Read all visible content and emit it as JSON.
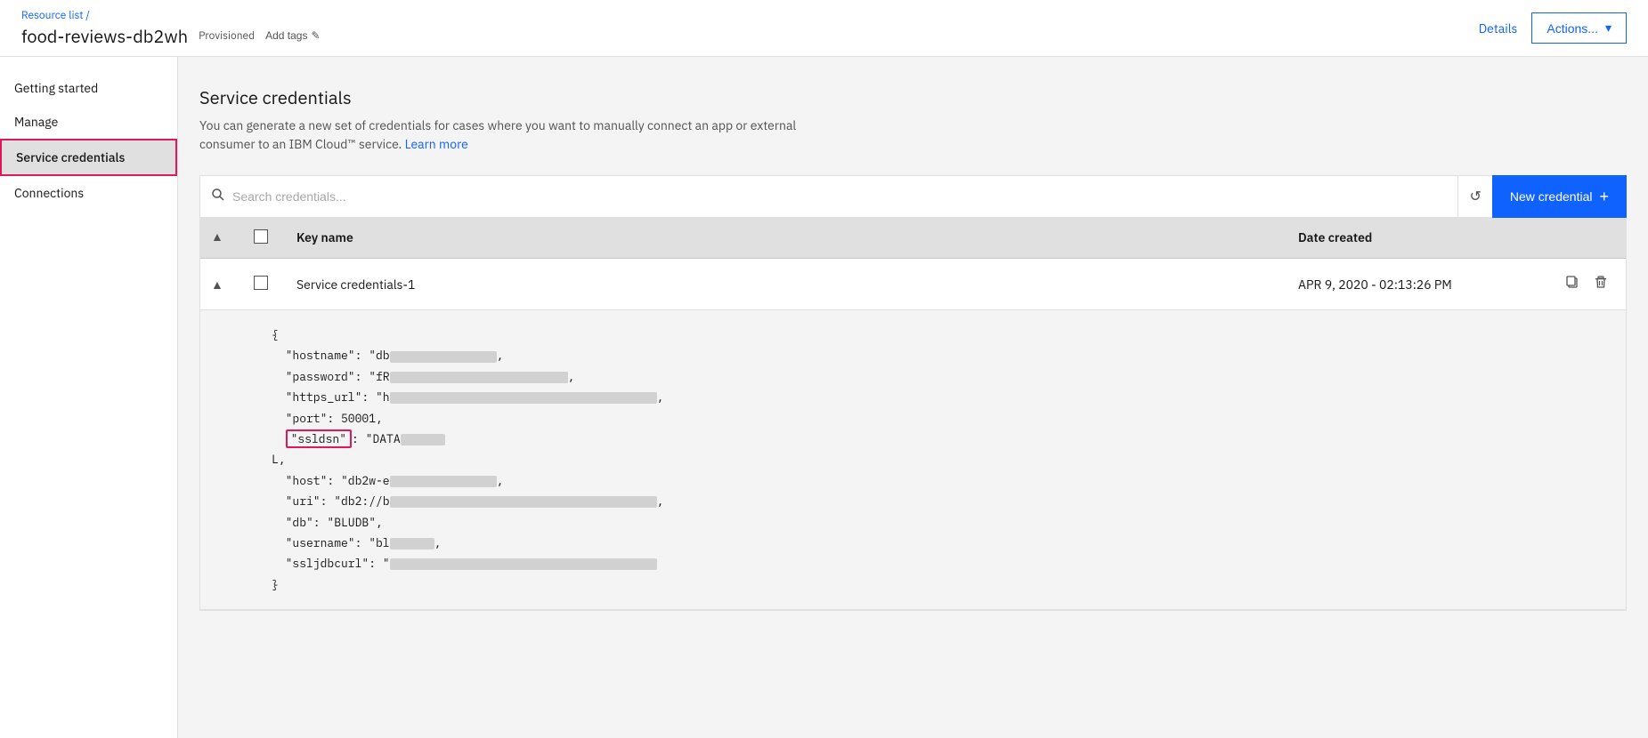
{
  "breadcrumb": {
    "label": "Resource list",
    "separator": "/"
  },
  "header": {
    "title": "food-reviews-db2wh",
    "status": "Provisioned",
    "add_tags_label": "Add tags",
    "details_label": "Details",
    "actions_label": "Actions..."
  },
  "sidebar": {
    "items": [
      {
        "id": "getting-started",
        "label": "Getting started",
        "active": false
      },
      {
        "id": "manage",
        "label": "Manage",
        "active": false
      },
      {
        "id": "service-credentials",
        "label": "Service credentials",
        "active": true
      },
      {
        "id": "connections",
        "label": "Connections",
        "active": false
      }
    ]
  },
  "main": {
    "section_title": "Service credentials",
    "section_desc": "You can generate a new set of credentials for cases where you want to manually connect an app or external consumer to an IBM Cloud™ service.",
    "learn_more_label": "Learn more",
    "search_placeholder": "Search credentials...",
    "new_credential_label": "New credential",
    "table": {
      "headers": [
        {
          "id": "expand",
          "label": ""
        },
        {
          "id": "checkbox",
          "label": ""
        },
        {
          "id": "key-name",
          "label": "Key name"
        },
        {
          "id": "date-created",
          "label": "Date created"
        },
        {
          "id": "actions",
          "label": ""
        }
      ],
      "rows": [
        {
          "id": "service-credentials-1",
          "key_name": "Service credentials-1",
          "date_created": "APR 9, 2020 - 02:13:26 PM",
          "expanded": true,
          "json_content": [
            {
              "line": "{"
            },
            {
              "line": "  \"hostname\": \"db",
              "key": "hostname",
              "value_blurred": true,
              "blur_size": "md"
            },
            {
              "line": "  \"password\": \"fR",
              "key": "password",
              "value_blurred": true,
              "blur_size": "lg"
            },
            {
              "line": "  \"https_url\": \"h",
              "key": "https_url",
              "value_blurred": true,
              "blur_size": "xl"
            },
            {
              "line": "  \"port\": 50001,",
              "key": "port",
              "value_blurred": false
            },
            {
              "line": "  \"ssldsn\": \"DATA",
              "key": "ssldsn",
              "highlighted": true,
              "value_blurred": true,
              "blur_size": "sm"
            },
            {
              "line": "L,",
              "continuation": true
            },
            {
              "line": "  \"host\": \"db2w-e",
              "key": "host",
              "value_blurred": true,
              "blur_size": "md"
            },
            {
              "line": "  \"uri\": \"db2://b",
              "key": "uri",
              "value_blurred": true,
              "blur_size": "xl"
            },
            {
              "line": "  \"db\": \"BLUDB\",",
              "key": "db",
              "value_blurred": false
            },
            {
              "line": "  \"username\": \"bl",
              "key": "username",
              "value_blurred": true,
              "blur_size": "sm"
            },
            {
              "line": "  \"ssljdbcurl\": \"",
              "key": "ssljdbcurl",
              "value_blurred": true,
              "blur_size": "xl"
            },
            {
              "line": "}"
            }
          ]
        }
      ]
    }
  }
}
